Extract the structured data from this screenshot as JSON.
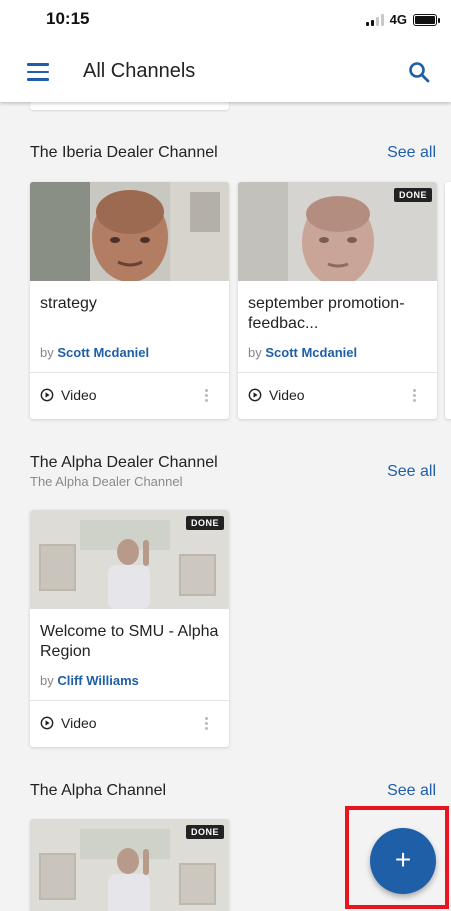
{
  "status_bar": {
    "time": "10:15",
    "network": "4G"
  },
  "app_bar": {
    "title": "All Channels"
  },
  "sections": [
    {
      "title": "The Iberia Dealer Channel",
      "subtitle": "",
      "see_all": "See all",
      "cards": [
        {
          "title": "strategy",
          "by": "by",
          "author": "Scott Mcdaniel",
          "type": "Video",
          "done": ""
        },
        {
          "title": "september promotion- feedbac...",
          "by": "by",
          "author": "Scott Mcdaniel",
          "type": "Video",
          "done": "DONE"
        }
      ]
    },
    {
      "title": "The Alpha Dealer Channel",
      "subtitle": "The Alpha Dealer Channel",
      "see_all": "See all",
      "cards": [
        {
          "title": "Welcome to SMU - Alpha Region",
          "by": "by",
          "author": "Cliff Williams",
          "type": "Video",
          "done": "DONE"
        }
      ]
    },
    {
      "title": "The Alpha Channel",
      "subtitle": "",
      "see_all": "See all",
      "cards": [
        {
          "done": "DONE"
        }
      ]
    }
  ],
  "fab": {
    "label": "+"
  },
  "colors": {
    "accent": "#1e5fa8",
    "highlight": "#e8141f",
    "background": "#f3f3f3"
  }
}
